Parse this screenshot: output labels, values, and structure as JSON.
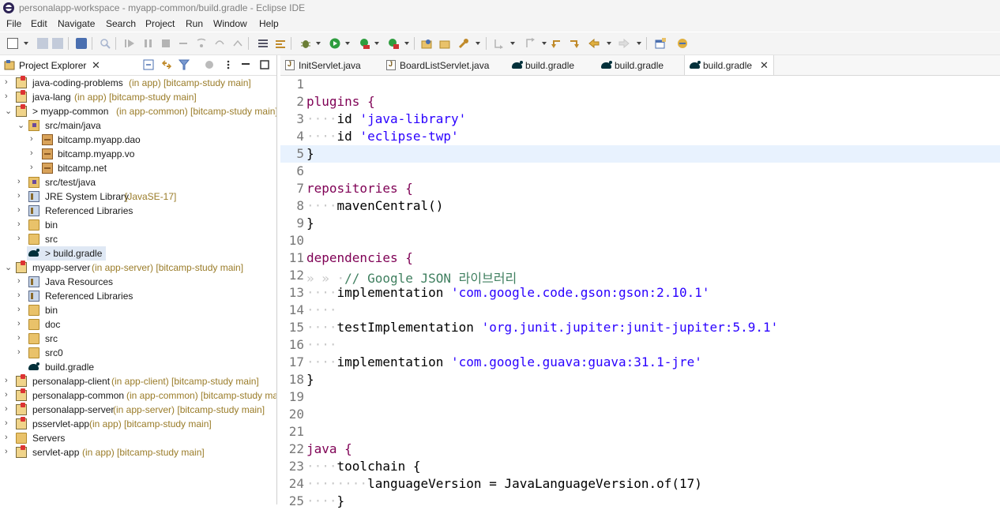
{
  "window": {
    "title": "personalapp-workspace - myapp-common/build.gradle - Eclipse IDE"
  },
  "menu": [
    "File",
    "Edit",
    "Navigate",
    "Search",
    "Project",
    "Run",
    "Window",
    "Help"
  ],
  "explorer": {
    "tab_label": "Project Explorer",
    "items": [
      {
        "name": "java-coding-problems",
        "suffix": " (in app) [bitcamp-study main]"
      },
      {
        "name": "java-lang",
        "suffix": " (in app) [bitcamp-study main]"
      },
      {
        "name": "> myapp-common",
        "suffix": " (in app-common) [bitcamp-study main]"
      },
      {
        "name": "src/main/java",
        "suffix": ""
      },
      {
        "name": "bitcamp.myapp.dao",
        "suffix": ""
      },
      {
        "name": "bitcamp.myapp.vo",
        "suffix": ""
      },
      {
        "name": "bitcamp.net",
        "suffix": ""
      },
      {
        "name": "src/test/java",
        "suffix": ""
      },
      {
        "name": "JRE System Library",
        "suffix": " [JavaSE-17]"
      },
      {
        "name": "Referenced Libraries",
        "suffix": ""
      },
      {
        "name": "bin",
        "suffix": ""
      },
      {
        "name": "src",
        "suffix": ""
      },
      {
        "name": "> build.gradle",
        "suffix": ""
      },
      {
        "name": "myapp-server",
        "suffix": " (in app-server) [bitcamp-study main]"
      },
      {
        "name": "Java Resources",
        "suffix": ""
      },
      {
        "name": "Referenced Libraries",
        "suffix": ""
      },
      {
        "name": "bin",
        "suffix": ""
      },
      {
        "name": "doc",
        "suffix": ""
      },
      {
        "name": "src",
        "suffix": ""
      },
      {
        "name": "src0",
        "suffix": ""
      },
      {
        "name": "build.gradle",
        "suffix": ""
      },
      {
        "name": "personalapp-client",
        "suffix": " (in app-client) [bitcamp-study main]"
      },
      {
        "name": "personalapp-common",
        "suffix": " (in app-common) [bitcamp-study main]"
      },
      {
        "name": "personalapp-server",
        "suffix": " (in app-server) [bitcamp-study main]"
      },
      {
        "name": "psservlet-app",
        "suffix": " (in app) [bitcamp-study main]"
      },
      {
        "name": "Servers",
        "suffix": ""
      },
      {
        "name": "servlet-app",
        "suffix": " (in app) [bitcamp-study main]"
      }
    ]
  },
  "editor": {
    "tabs": [
      "InitServlet.java",
      "BoardListServlet.java",
      "build.gradle",
      "build.gradle",
      "build.gradle"
    ],
    "line_numbers": [
      "1",
      "2",
      "3",
      "4",
      "5",
      "6",
      "7",
      "8",
      "9",
      "10",
      "11",
      "12",
      "13",
      "14",
      "15",
      "16",
      "17",
      "18",
      "19",
      "20",
      "21",
      "22",
      "23",
      "24",
      "25"
    ],
    "code": {
      "l2": "plugins {",
      "l3_kw": "id",
      "l3_str": "'java-library'",
      "l4_kw": "id",
      "l4_str": "'eclipse-twp'",
      "l5": "}",
      "l7": "repositories {",
      "l8": "mavenCentral()",
      "l9": "}",
      "l11": "dependencies {",
      "l12": "// Google JSON 라이브러리",
      "l13_kw": "implementation",
      "l13_str": "'com.google.code.gson:gson:2.10.1'",
      "l15_kw": "testImplementation",
      "l15_str": "'org.junit.jupiter:junit-jupiter:5.9.1'",
      "l17_kw": "implementation",
      "l17_str": "'com.google.guava:guava:31.1-jre'",
      "l18": "}",
      "l22": "java {",
      "l23": "toolchain {",
      "l24": "languageVersion = JavaLanguageVersion.of(17)",
      "l25": "}"
    }
  },
  "colors": {
    "keyword": "#7f0055",
    "string": "#2a00ff",
    "comment": "#3f7f5f",
    "current_line": "#e8f2fe",
    "selection": "#dfe8f4"
  }
}
